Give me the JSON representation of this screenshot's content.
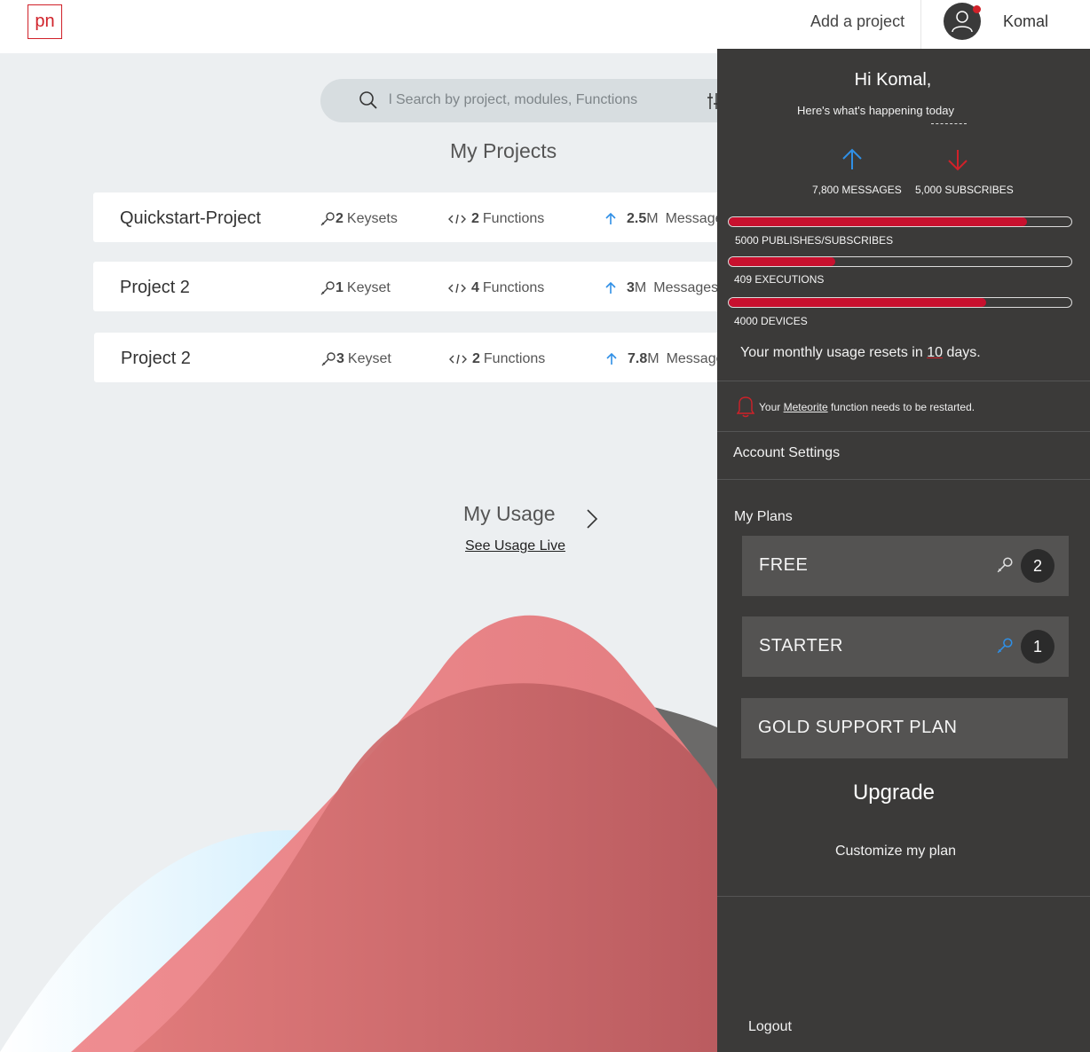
{
  "header": {
    "logo_text": "pn",
    "add_project": "Add a project",
    "username": "Komal"
  },
  "search": {
    "placeholder": "l Search by project, modules, Functions"
  },
  "projects": {
    "title": "My Projects",
    "rows": [
      {
        "name": "Quickstart-Project",
        "keys_count": "2",
        "keys_label": "Keysets",
        "func_count": "2",
        "func_label": "Functions",
        "msg_count": "2.5",
        "msg_unit": "M",
        "msg_label": "Messages"
      },
      {
        "name": "Project 2",
        "keys_count": "1",
        "keys_label": "Keyset",
        "func_count": "4",
        "func_label": "Functions",
        "msg_count": "3",
        "msg_unit": "M",
        "msg_label": "Messages"
      },
      {
        "name": "Project 2",
        "keys_count": "3",
        "keys_label": "Keyset",
        "func_count": "2",
        "func_label": "Functions",
        "msg_count": "7.8",
        "msg_unit": "M",
        "msg_label": "Messages"
      }
    ]
  },
  "usage": {
    "title": "My Usage",
    "link": "See Usage Live"
  },
  "panel": {
    "greeting": "Hi Komal,",
    "subtitle": "Here's what's happening today",
    "messages_stat": "7,800 MESSAGES",
    "subscribes_stat": "5,000 SUBSCRIBES",
    "bars": [
      {
        "label": "5000 PUBLISHES/SUBSCRIBES",
        "fill": 0.87
      },
      {
        "label": "409 EXECUTIONS",
        "fill": 0.31
      },
      {
        "label": "4000 DEVICES",
        "fill": 0.75
      }
    ],
    "reset_prefix": "Your monthly usage resets in",
    "reset_days": "10",
    "reset_suffix": "days.",
    "notice_prefix": "Your",
    "notice_link": "Meteorite",
    "notice_suffix": "function needs to be restarted.",
    "account_settings": "Account Settings",
    "my_plans": "My Plans",
    "plans": [
      {
        "name": "FREE",
        "badge": "2"
      },
      {
        "name": "STARTER",
        "badge": "1"
      },
      {
        "name": "GOLD SUPPORT PLAN"
      }
    ],
    "upgrade": "Upgrade",
    "customize": "Customize my plan",
    "logout": "Logout"
  },
  "colors": {
    "brand_red": "#d02129",
    "panel_bg": "#3b3a39",
    "accent_blue": "#2f8fe6"
  }
}
